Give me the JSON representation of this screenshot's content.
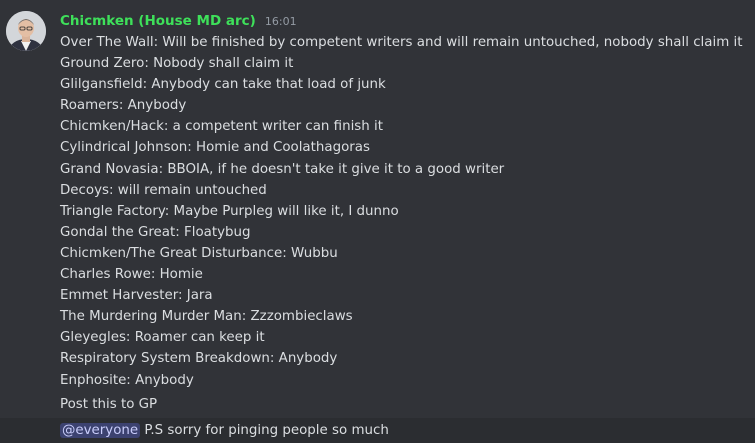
{
  "message": {
    "username": "Chicmken (House MD arc)",
    "timestamp": "16:01",
    "lines": [
      "Over The Wall: Will be finished by competent writers and will remain untouched, nobody shall claim it",
      "Ground Zero: Nobody shall claim it",
      "Glilgansfield: Anybody can take that load of junk",
      "Roamers: Anybody",
      "Chicmken/Hack: a competent writer can finish it",
      "Cylindrical Johnson: Homie and Coolathagoras",
      "Grand Novasia: BBOIA, if he doesn't take it give it to a good writer",
      "Decoys: will remain untouched",
      "Triangle Factory: Maybe Purpleg will like it, I dunno",
      "Gondal the Great: Floatybug",
      "Chicmken/The Great Disturbance: Wubbu",
      "Charles Rowe: Homie",
      "Emmet Harvester: Jara",
      "The Murdering Murder Man: Zzzombieclaws",
      "Gleyegles: Roamer can keep it",
      "Respiratory System Breakdown: Anybody",
      "Enphosite: Anybody"
    ]
  },
  "followup": {
    "text": "Post this to GP"
  },
  "final": {
    "mention": "@everyone",
    "text": "P.S sorry for pinging people so much"
  },
  "colors": {
    "background": "#313338",
    "username": "#3ee05a",
    "highlight_row": "#2b2d31",
    "mention_bg": "#3c4270"
  }
}
